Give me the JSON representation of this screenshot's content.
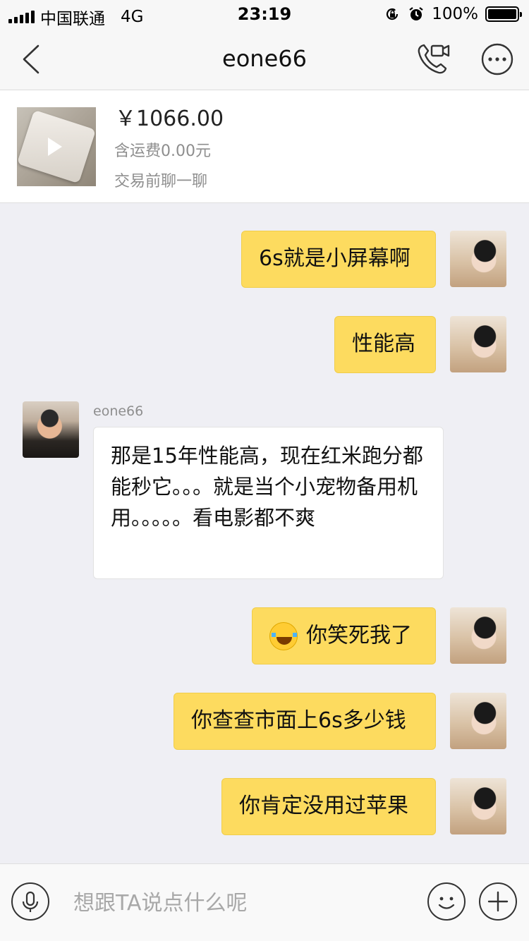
{
  "status_bar": {
    "carrier": "中国联通",
    "network": "4G",
    "time": "23:19",
    "battery": "100%"
  },
  "nav": {
    "title": "eone66",
    "icons": [
      "back-chevron-icon",
      "video-call-icon",
      "more-icon"
    ]
  },
  "product": {
    "price": "￥1066.00",
    "shipping": "含运费0.00元",
    "hint": "交易前聊一聊",
    "icon": "play-icon"
  },
  "messages": [
    {
      "side": "right",
      "text": "6s就是小屏幕啊"
    },
    {
      "side": "right",
      "text": "性能高"
    },
    {
      "side": "left",
      "sender": "eone66",
      "text": "那是15年性能高，现在红米跑分都能秒它。。。就是当个小宠物备用机用。。。。。看电影都不爽"
    },
    {
      "side": "right",
      "emoji": "laughing-tears-emoji",
      "text": "你笑死我了"
    },
    {
      "side": "right",
      "text": "你查查市面上6s多少钱"
    },
    {
      "side": "right",
      "text": "你肯定没用过苹果"
    }
  ],
  "input_bar": {
    "placeholder": "想跟TA说点什么呢",
    "icons": [
      "microphone-icon",
      "emoji-icon",
      "plus-icon"
    ]
  },
  "colors": {
    "self_bubble": "#fddb5f",
    "other_bubble": "#ffffff",
    "chat_background": "#efeff4"
  }
}
